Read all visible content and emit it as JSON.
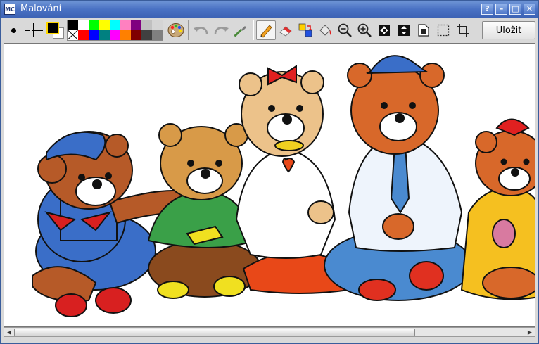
{
  "window": {
    "title": "Malování",
    "app_icon_text": "MC"
  },
  "title_buttons": {
    "help": "?",
    "minimize": "–",
    "maximize": "□",
    "close": "✕"
  },
  "toolbar": {
    "save_label": "Uložit",
    "palette_colors": [
      "#000000",
      "#ffffff",
      "#00ff00",
      "#ffff00",
      "#00ffff",
      "#ff80c0",
      "#800080",
      "#c0c0c0",
      "#d4d4d4",
      "transparent",
      "#ff0000",
      "#0000ff",
      "#008080",
      "#ff00ff",
      "#ff8000",
      "#800000",
      "#404040",
      "#808080"
    ],
    "foreground_color": "#000000",
    "background_color": "#ffffff"
  },
  "canvas": {
    "content": "teddy-bears-coloring-page"
  }
}
